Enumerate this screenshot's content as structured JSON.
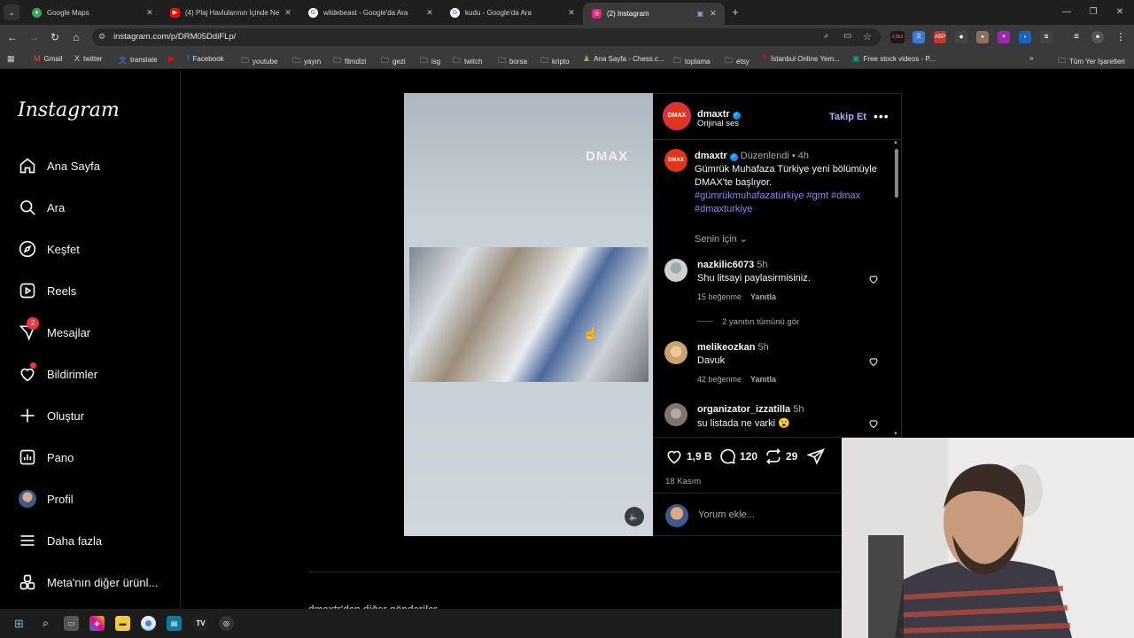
{
  "browser": {
    "tabs": [
      {
        "title": "Google Maps",
        "color": "#34a853",
        "active": false
      },
      {
        "title": "(4) Plaj Havlularının İçinde Ne S",
        "color": "#ff0000",
        "active": false
      },
      {
        "title": "wildebeast - Google'da Ara",
        "color": "#4285f4",
        "active": false
      },
      {
        "title": "kudu - Google'da Ara",
        "color": "#4285f4",
        "active": false
      },
      {
        "title": "(2) Instagram",
        "color": "#d62976",
        "active": true
      }
    ],
    "url": "instagram.com/p/DRM05DdiFLp/",
    "new_tab": "+",
    "ext_badge": "2.952",
    "bookmarks": [
      {
        "label": "Gmail",
        "icon": "gmail-icon"
      },
      {
        "label": "twitter",
        "icon": "x-icon"
      },
      {
        "label": "translate",
        "icon": "translate-icon"
      },
      {
        "label": "",
        "icon": "youtube-icon"
      },
      {
        "label": "Facebook",
        "icon": "facebook-icon"
      },
      {
        "label": "youtube",
        "icon": "folder-icon"
      },
      {
        "label": "yayın",
        "icon": "folder-icon"
      },
      {
        "label": "filmdizi",
        "icon": "folder-icon"
      },
      {
        "label": "gezi",
        "icon": "folder-icon"
      },
      {
        "label": "isg",
        "icon": "folder-icon"
      },
      {
        "label": "twitch",
        "icon": "folder-icon"
      },
      {
        "label": "borsa",
        "icon": "folder-icon"
      },
      {
        "label": "kripto",
        "icon": "folder-icon"
      },
      {
        "label": "Ana Sayfa - Chess.c...",
        "icon": "chess-icon"
      },
      {
        "label": "toplama",
        "icon": "folder-icon"
      },
      {
        "label": "etsy",
        "icon": "folder-icon"
      },
      {
        "label": "İstanbul Online Yem...",
        "icon": "yemeksepeti-icon"
      },
      {
        "label": "Free stock videos - P...",
        "icon": "pexels-icon"
      }
    ],
    "all_bookmarks": "Tüm Yer İşaretleri",
    "overflow": "»"
  },
  "sidebar": {
    "logo": "Instagram",
    "items": [
      {
        "label": "Ana Sayfa",
        "icon": "home-icon"
      },
      {
        "label": "Ara",
        "icon": "search-icon"
      },
      {
        "label": "Keşfet",
        "icon": "compass-icon"
      },
      {
        "label": "Reels",
        "icon": "reels-icon"
      },
      {
        "label": "Mesajlar",
        "icon": "messenger-icon",
        "badge": "2"
      },
      {
        "label": "Bildirimler",
        "icon": "heart-icon"
      },
      {
        "label": "Oluştur",
        "icon": "plus-icon"
      },
      {
        "label": "Pano",
        "icon": "dashboard-icon"
      },
      {
        "label": "Profil",
        "icon": "profile-avatar"
      },
      {
        "label": "Daha fazla",
        "icon": "menu-icon"
      },
      {
        "label": "Meta'nın diğer ürünl...",
        "icon": "apps-icon"
      }
    ]
  },
  "post": {
    "watermark": "DMAX",
    "account": "dmaxtr",
    "audio": "Orijinal ses",
    "follow_label": "Takip Et",
    "caption": {
      "edited": "Düzenlendi",
      "time": "4h",
      "text": "Gümrük Muhafaza Türkiye yeni bölümüyle DMAX'te başlıyor.",
      "hashtags": "#gümrükmuhafazatürkiye #gmt #dmax #dmaxturkiye"
    },
    "sort_label": "Senin için",
    "comments": [
      {
        "user": "nazkilic6073",
        "time": "5h",
        "text": "Shu litsayi paylasirmisiniz.",
        "likes": "15 beğenme",
        "reply": "Yanıtla",
        "replies": "2 yanıtın tümünü gör"
      },
      {
        "user": "melikeozkan",
        "time": "5h",
        "text": "Davuk",
        "likes": "42 beğenme",
        "reply": "Yanıtla"
      },
      {
        "user": "organizator_izzatilla",
        "time": "5h",
        "text": "su listada ne varki 😮"
      }
    ],
    "like_count": "1,9 B",
    "comment_count": "120",
    "repost_count": "29",
    "date": "18 Kasım",
    "add_comment_placeholder": "Yorum ekle...",
    "more_posts": "dmaxtr'den diğer gönderiler"
  }
}
